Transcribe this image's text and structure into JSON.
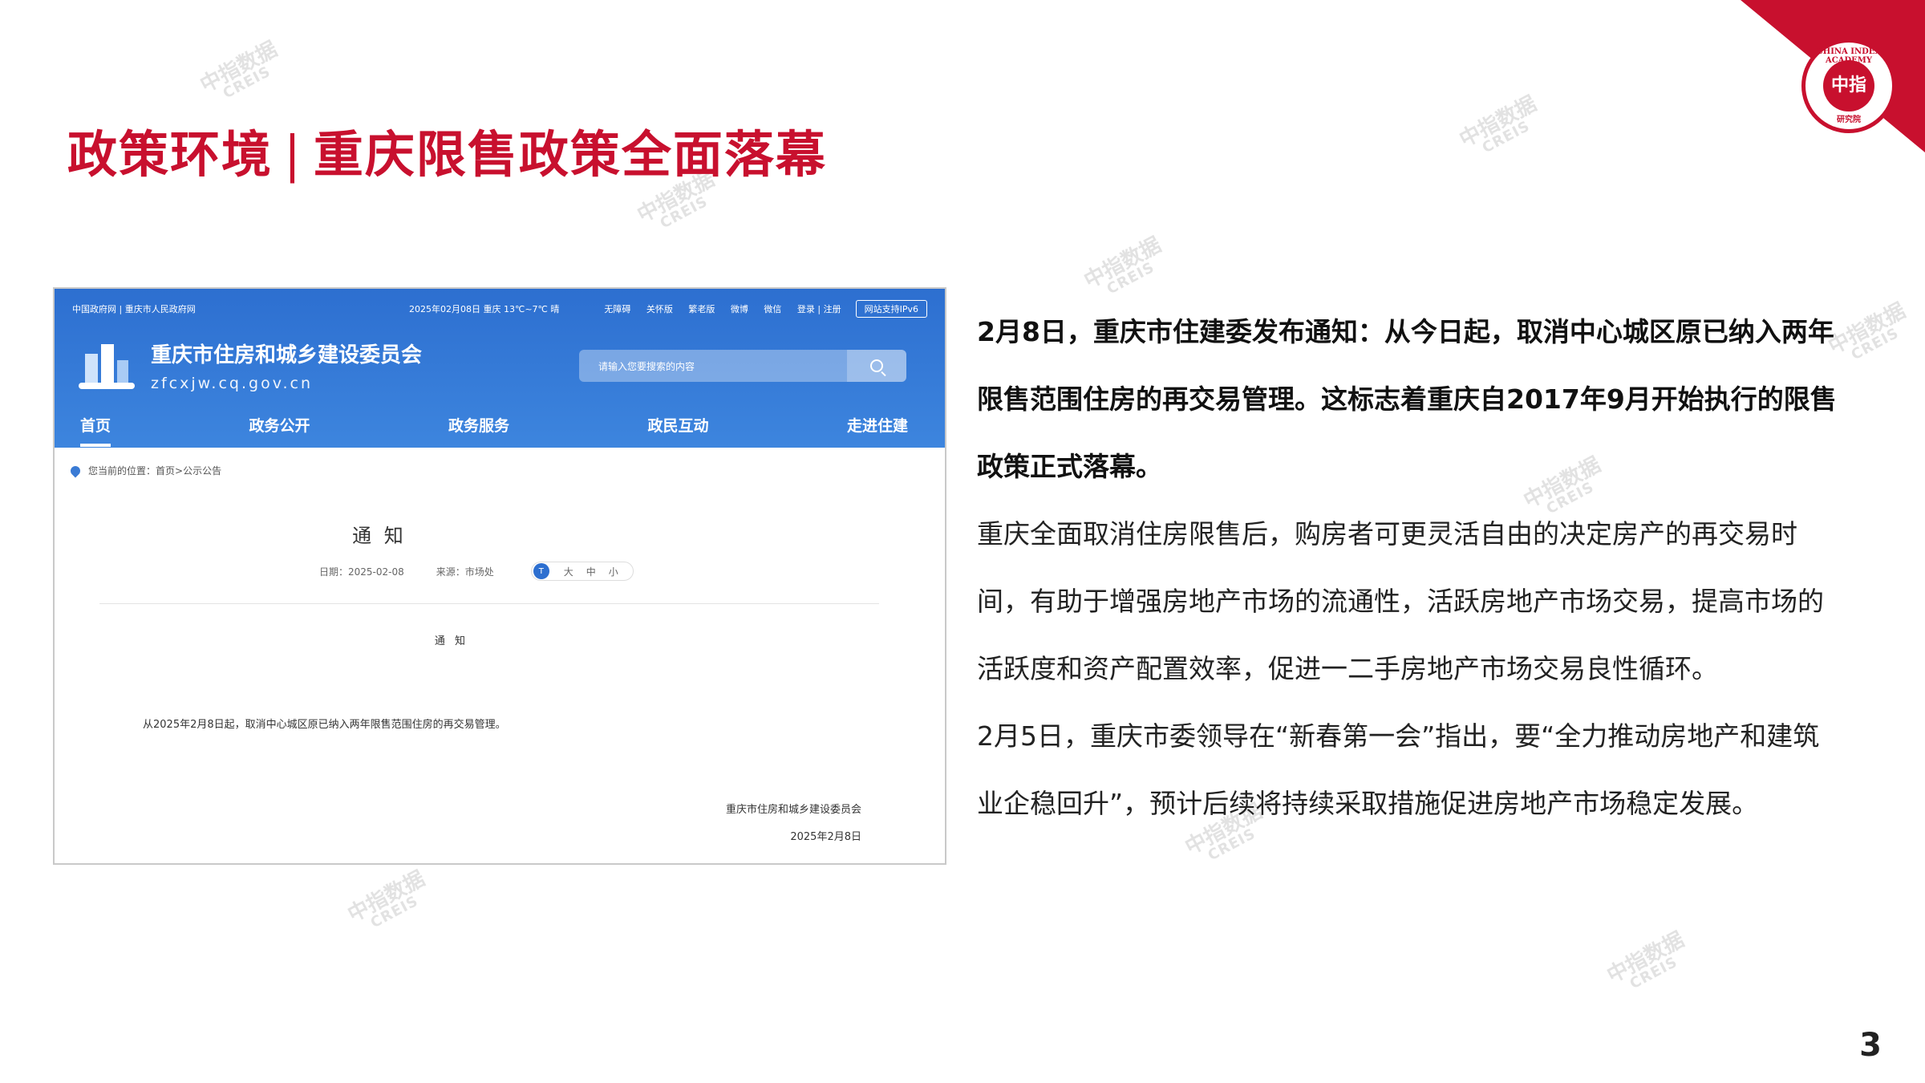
{
  "title": {
    "prefix": "政策环境",
    "separator": "|",
    "main": "重庆限售政策全面落幕"
  },
  "logo": {
    "ring_text": "CHINA INDEX ACADEMY",
    "inner_text": "中指",
    "bottom_text": "研究院",
    "icon": "china-index-academy-seal"
  },
  "watermark": {
    "cn": "中指数据",
    "en": "CREIS"
  },
  "screenshot": {
    "top_links_left": "中国政府网 | 重庆市人民政府网",
    "top_date": "2025年02月08日 重庆 13℃~7℃ 晴",
    "top_links": [
      "无障碍",
      "关怀版",
      "繁老版",
      "微博",
      "微信",
      "登录 | 注册"
    ],
    "ipv6": "网站支持IPv6",
    "org_name": "重庆市住房和城乡建设委员会",
    "org_domain": "zfcxjw.cq.gov.cn",
    "search_placeholder": "请输入您要搜索的内容",
    "nav": [
      "首页",
      "政务公开",
      "政务服务",
      "政民互动",
      "走进住建"
    ],
    "breadcrumb_label": "您当前的位置：",
    "breadcrumb_path": "首页>公示公告",
    "notice_title": "通 知",
    "date_label": "日期：2025-02-08",
    "source_label": "来源：市场处",
    "size_options": [
      "大",
      "中",
      "小"
    ],
    "body_heading": "通 知",
    "body_text": "从2025年2月8日起，取消中心城区原已纳入两年限售范围住房的再交易管理。",
    "sign_org": "重庆市住房和城乡建设委员会",
    "sign_date": "2025年2月8日"
  },
  "content": {
    "bold_para": "2月8日，重庆市住建委发布通知：从今日起，取消中心城区原已纳入两年限售范围住房的再交易管理。这标志着重庆自2017年9月开始执行的限售政策正式落幕。",
    "para1": "重庆全面取消住房限售后，购房者可更灵活自由的决定房产的再交易时间，有助于增强房地产市场的流通性，活跃房地产市场交易，提高市场的活跃度和资产配置效率，促进一二手房地产市场交易良性循环。",
    "para2": "2月5日，重庆市委领导在“新春第一会”指出，要“全力推动房地产和建筑业企稳回升”，预计后续将持续采取措施促进房地产市场稳定发展。"
  },
  "page_number": "3",
  "colors": {
    "accent": "#c8102e",
    "site_blue": "#2d6fd0"
  }
}
